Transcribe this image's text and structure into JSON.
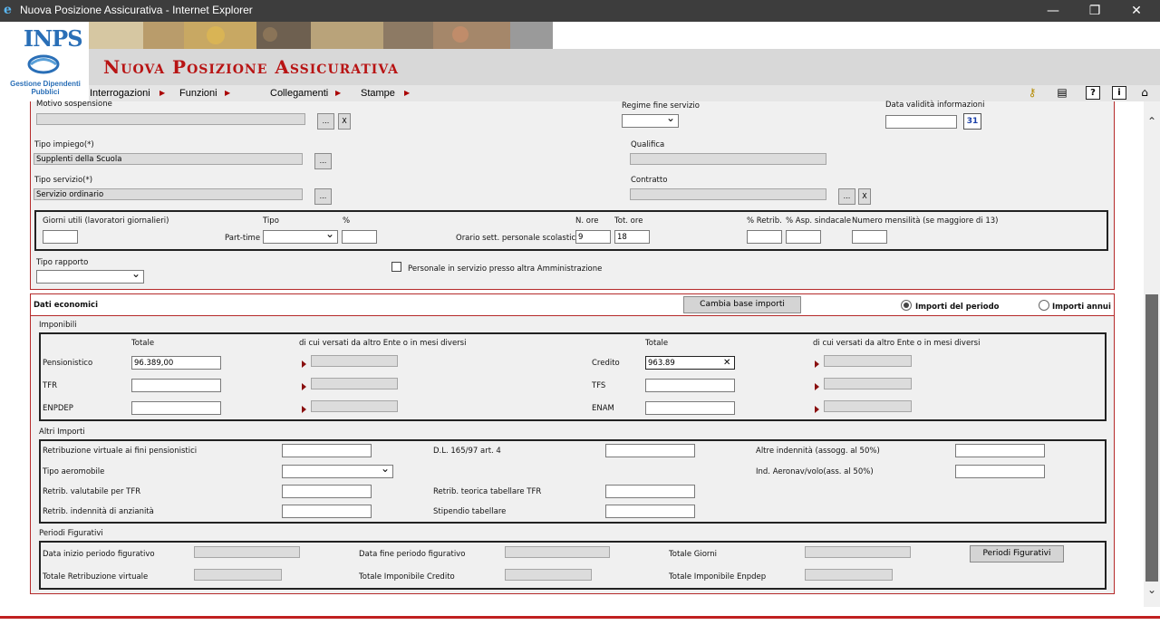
{
  "window": {
    "title": "Nuova Posizione Assicurativa - Internet Explorer",
    "controls": {
      "minimize": "—",
      "restore": "❐",
      "close": "✕"
    }
  },
  "header": {
    "logo_text": "INPS",
    "logo_sub": "Gestione Dipendenti Pubblici",
    "app_title": "Nuova Posizione Assicurativa",
    "menu": [
      "Interrogazioni",
      "Funzioni",
      "Collegamenti",
      "Stampe"
    ],
    "tools": [
      "key-icon",
      "printer-icon",
      "help-icon",
      "info-icon",
      "sitemap-icon"
    ]
  },
  "top_section": {
    "motivo_sospensione": {
      "label": "Motivo sospensione",
      "value": ""
    },
    "regime_fine_servizio": {
      "label": "Regime fine servizio",
      "value": ""
    },
    "data_validita": {
      "label": "Data validità informazioni",
      "value": "",
      "calendar_label": "31"
    },
    "tipo_impiego": {
      "label": "Tipo impiego(*)",
      "value": "Supplenti della Scuola"
    },
    "qualifica": {
      "label": "Qualifica",
      "value": ""
    },
    "tipo_servizio": {
      "label": "Tipo servizio(*)",
      "value": "Servizio ordinario"
    },
    "contratto": {
      "label": "Contratto",
      "value": ""
    },
    "browse_label": "...",
    "clear_label": "X",
    "giorni_utili": {
      "label": "Giorni utili (lavoratori giornalieri)",
      "value": ""
    },
    "part_time": {
      "label": "Part-time",
      "tipo_label": "Tipo",
      "pct_label": "%",
      "tipo_value": "",
      "pct_value": ""
    },
    "orario": {
      "label": "Orario sett. personale scolastico",
      "n_ore_label": "N. ore",
      "tot_ore_label": "Tot. ore",
      "n_ore": "9",
      "tot_ore": "18"
    },
    "pct_retrib": {
      "label": "% Retrib.",
      "value": ""
    },
    "pct_asp": {
      "label": "% Asp. sindacale",
      "value": ""
    },
    "mensilita": {
      "label": "Numero mensilità (se maggiore di 13)",
      "value": ""
    },
    "tipo_rapporto": {
      "label": "Tipo rapporto",
      "value": ""
    },
    "altra_amm": {
      "label": "Personale in servizio presso altra Amministrazione",
      "checked": false
    }
  },
  "dati_economici": {
    "title": "Dati economici",
    "cambia_button": "Cambia base importi",
    "radio_periodo": "Importi del periodo",
    "radio_annui": "Importi annui",
    "imponibili": {
      "title": "Imponibili",
      "totale_label": "Totale",
      "versati_label": "di cui versati da altro Ente o in mesi diversi",
      "left_rows": [
        {
          "label": "Pensionistico",
          "value": "96.389,00"
        },
        {
          "label": "TFR",
          "value": ""
        },
        {
          "label": "ENPDEP",
          "value": ""
        }
      ],
      "right_rows": [
        {
          "label": "Credito",
          "value": "963.89"
        },
        {
          "label": "TFS",
          "value": ""
        },
        {
          "label": "ENAM",
          "value": ""
        }
      ],
      "clear_icon": "✕"
    },
    "altri_importi": {
      "title": "Altri Importi",
      "retrib_virtuale": "Retribuzione virtuale ai fini pensionistici",
      "dl165": "D.L. 165/97 art. 4",
      "altre_indennita": "Altre indennità (assogg. al 50%)",
      "tipo_aeromobile": "Tipo aeromobile",
      "ind_aeronav": "Ind. Aeronav/volo(ass. al 50%)",
      "retrib_tfr": "Retrib. valutabile per TFR",
      "retrib_teorica": "Retrib. teorica tabellare TFR",
      "retrib_anzianita": "Retrib. indennità di anzianità",
      "stipendio": "Stipendio tabellare"
    },
    "periodi": {
      "title": "Periodi Figurativi",
      "data_inizio": "Data inizio periodo figurativo",
      "data_fine": "Data fine periodo figurativo",
      "totale_giorni": "Totale Giorni",
      "button": "Periodi Figurativi",
      "tot_retrib": "Totale Retribuzione virtuale",
      "tot_credito": "Totale Imponibile Credito",
      "tot_enpdep": "Totale Imponibile Enpdep"
    }
  },
  "scroll": {
    "up": "⌃",
    "down": "⌄"
  }
}
